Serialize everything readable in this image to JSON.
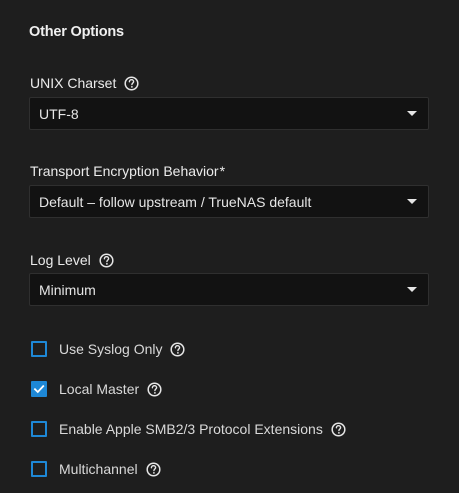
{
  "section": {
    "title": "Other Options"
  },
  "fields": {
    "unix_charset": {
      "label": "UNIX Charset",
      "value": "UTF-8"
    },
    "transport_encryption": {
      "label": "Transport Encryption Behavior",
      "required_mark": "*",
      "value": "Default – follow upstream / TrueNAS default"
    },
    "log_level": {
      "label": "Log Level",
      "value": "Minimum"
    }
  },
  "checkboxes": [
    {
      "label": "Use Syslog Only",
      "checked": false
    },
    {
      "label": "Local Master",
      "checked": true
    },
    {
      "label": "Enable Apple SMB2/3 Protocol Extensions",
      "checked": false
    },
    {
      "label": "Multichannel",
      "checked": false
    }
  ],
  "colors": {
    "background": "#1e1e1e",
    "field_background": "#121212",
    "accent": "#1e88d6",
    "text": "#e8e8e8"
  },
  "icons": {
    "help": "help-circle-icon",
    "dropdown": "chevron-down-icon",
    "check": "check-icon"
  }
}
